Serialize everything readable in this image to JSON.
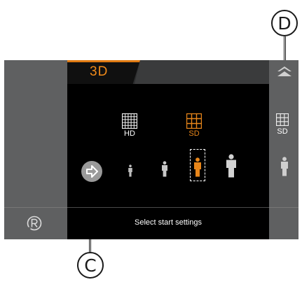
{
  "callouts": {
    "d": "D",
    "c": "C"
  },
  "tabs": {
    "active": "3D"
  },
  "resolutions": {
    "hd_label": "HD",
    "sd_label": "SD",
    "side_sd_label": "SD"
  },
  "status": {
    "text": "Select start settings"
  },
  "icons": {
    "tab_up": "double-chevron-up-icon",
    "start": "arrow-right-circle-icon",
    "reset": "r-circle-icon"
  },
  "colors": {
    "accent": "#e07a12",
    "panel": "#5f6061",
    "screen": "#000000"
  }
}
